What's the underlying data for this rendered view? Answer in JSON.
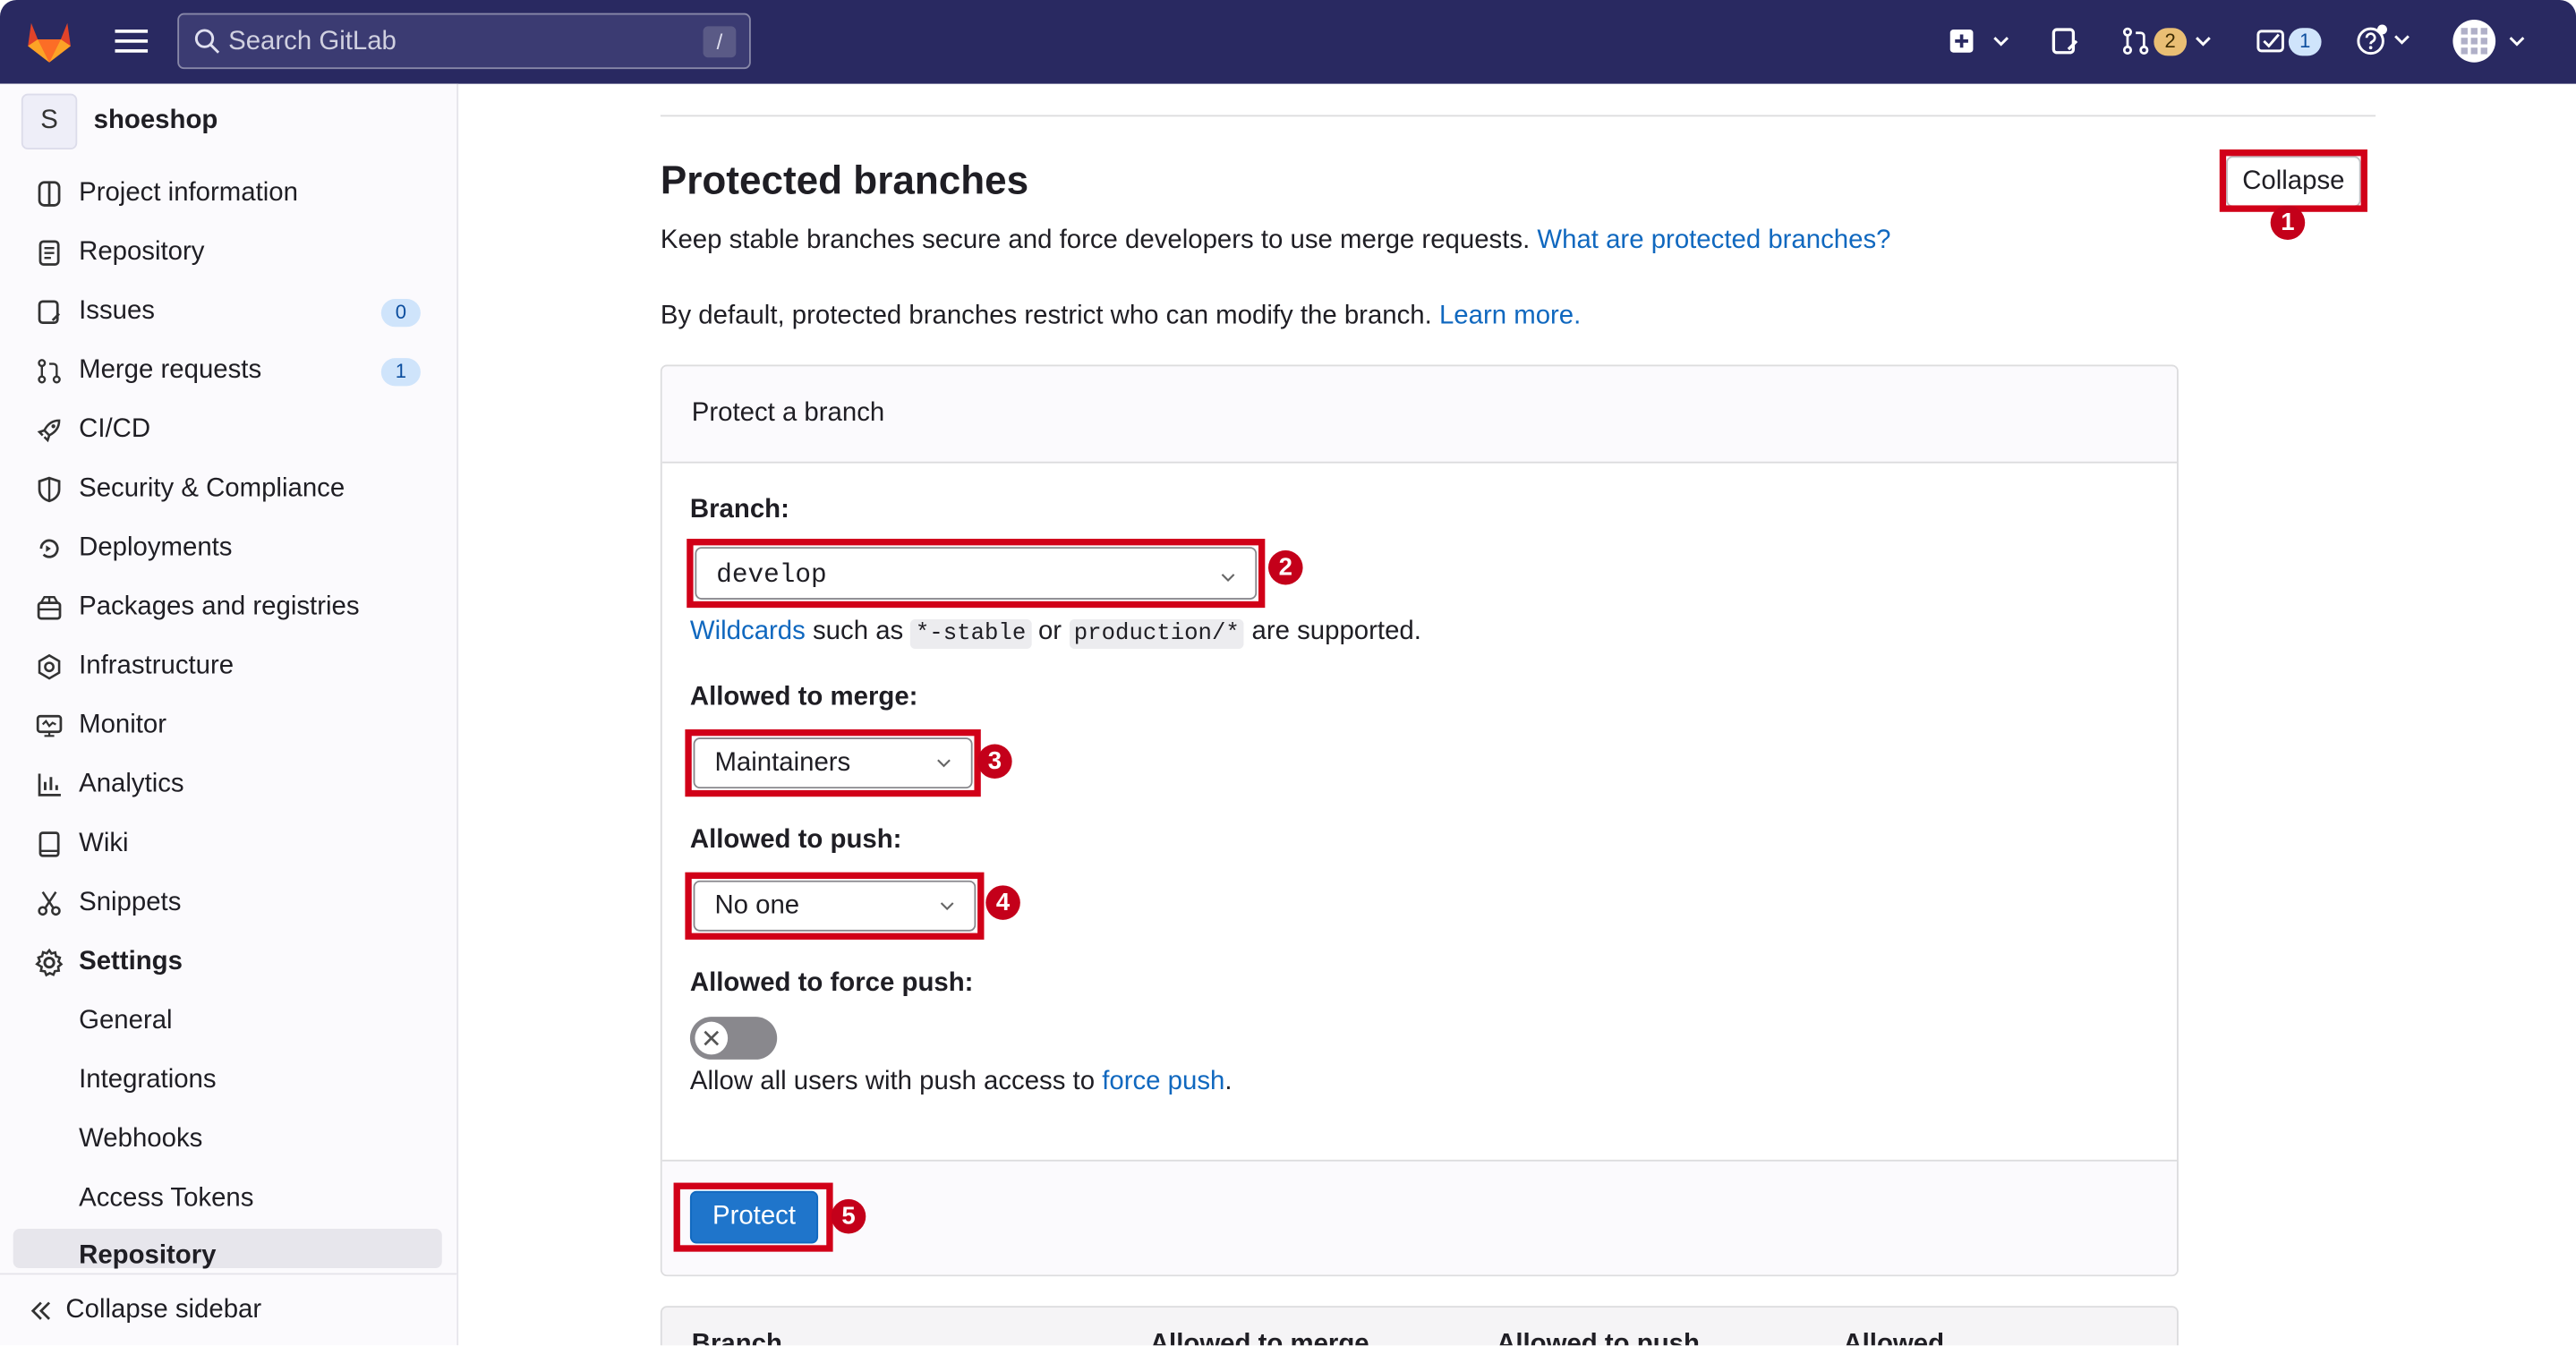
{
  "topbar": {
    "search_placeholder": "Search GitLab",
    "search_shortcut": "/",
    "merge_requests_count": "2",
    "todos_count": "1"
  },
  "sidebar": {
    "project_initial": "S",
    "project_name": "shoeshop",
    "items": [
      {
        "label": "Project information",
        "icon": "info-icon"
      },
      {
        "label": "Repository",
        "icon": "doc-icon"
      },
      {
        "label": "Issues",
        "icon": "issues-icon",
        "count": "0"
      },
      {
        "label": "Merge requests",
        "icon": "merge-request-icon",
        "count": "1"
      },
      {
        "label": "CI/CD",
        "icon": "rocket-icon"
      },
      {
        "label": "Security & Compliance",
        "icon": "shield-icon"
      },
      {
        "label": "Deployments",
        "icon": "deployments-icon"
      },
      {
        "label": "Packages and registries",
        "icon": "package-icon"
      },
      {
        "label": "Infrastructure",
        "icon": "cloud-gear-icon"
      },
      {
        "label": "Monitor",
        "icon": "monitor-icon"
      },
      {
        "label": "Analytics",
        "icon": "chart-icon"
      },
      {
        "label": "Wiki",
        "icon": "book-icon"
      },
      {
        "label": "Snippets",
        "icon": "scissors-icon"
      },
      {
        "label": "Settings",
        "icon": "gear-icon"
      }
    ],
    "settings_sub": [
      "General",
      "Integrations",
      "Webhooks",
      "Access Tokens",
      "Repository"
    ],
    "collapse_label": "Collapse sidebar"
  },
  "main": {
    "title": "Protected branches",
    "collapse_button": "Collapse",
    "intro": "Keep stable branches secure and force developers to use merge requests.",
    "intro_link": "What are protected branches?",
    "default_text": "By default, protected branches restrict who can modify the branch.",
    "learn_more": "Learn more.",
    "card": {
      "header": "Protect a branch",
      "branch_label": "Branch:",
      "branch_value": "develop",
      "wildcards_link": "Wildcards",
      "wildcards_such_as": "such as",
      "wildcard_example_1": "*-stable",
      "wildcards_or": "or",
      "wildcard_example_2": "production/*",
      "wildcards_suffix": "are supported.",
      "merge_label": "Allowed to merge:",
      "merge_value": "Maintainers",
      "push_label": "Allowed to push:",
      "push_value": "No one",
      "force_label": "Allowed to force push:",
      "force_enabled": false,
      "force_help_prefix": "Allow all users with push access to",
      "force_help_link": "force push",
      "force_help_suffix": ".",
      "protect_button": "Protect"
    },
    "table_headers": [
      "Branch",
      "Allowed to merge",
      "Allowed to push",
      "Allowed"
    ]
  },
  "annotations": [
    "1",
    "2",
    "3",
    "4",
    "5"
  ],
  "colors": {
    "highlight": "#d10018",
    "primary": "#1f75cb",
    "link": "#1068bf",
    "topbar": "#292961"
  }
}
